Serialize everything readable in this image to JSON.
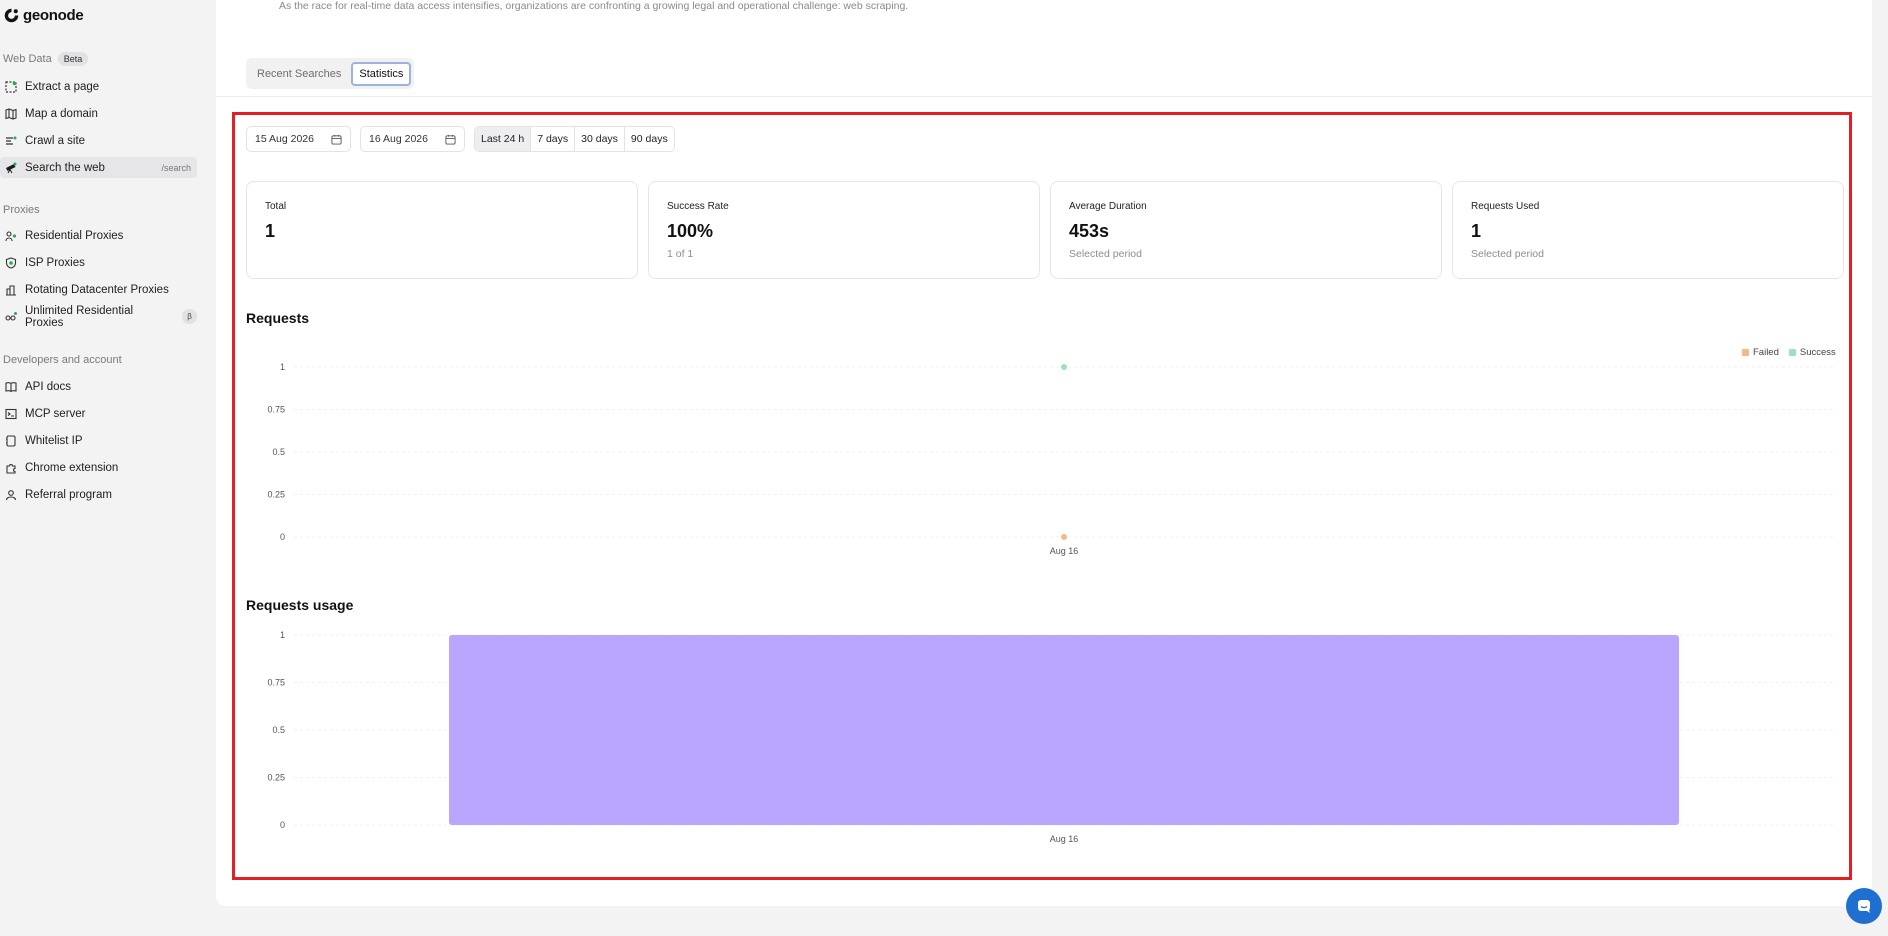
{
  "brand": {
    "name": "geonode"
  },
  "sidebar": {
    "sections": [
      {
        "label": "Web Data",
        "badge": "Beta"
      },
      {
        "label": "Proxies"
      },
      {
        "label": "Developers and account"
      }
    ],
    "web_data_items": [
      {
        "label": "Extract a page",
        "icon": "extract-icon"
      },
      {
        "label": "Map a domain",
        "icon": "map-icon"
      },
      {
        "label": "Crawl a site",
        "icon": "crawl-icon"
      },
      {
        "label": "Search the web",
        "icon": "telescope-icon",
        "shortcut": "/search",
        "active": true
      }
    ],
    "proxy_items": [
      {
        "label": "Residential Proxies",
        "icon": "residential-icon"
      },
      {
        "label": "ISP Proxies",
        "icon": "isp-shield-icon"
      },
      {
        "label": "Rotating Datacenter Proxies",
        "icon": "datacenter-icon"
      },
      {
        "label": "Unlimited Residential Proxies",
        "icon": "unlimited-icon",
        "badge": "β"
      }
    ],
    "dev_items": [
      {
        "label": "API docs",
        "icon": "book-icon"
      },
      {
        "label": "MCP server",
        "icon": "terminal-icon"
      },
      {
        "label": "Whitelist IP",
        "icon": "whitelist-icon"
      },
      {
        "label": "Chrome extension",
        "icon": "puzzle-icon"
      },
      {
        "label": "Referral program",
        "icon": "user-icon"
      }
    ]
  },
  "main": {
    "intro_text": "As the race for real-time data access intensifies, organizations are confronting a growing legal and operational challenge: web scraping.",
    "tabs": [
      {
        "label": "Recent Searches",
        "selected": false
      },
      {
        "label": "Statistics",
        "selected": true
      }
    ]
  },
  "filters": {
    "start_date": "15 Aug 2026",
    "end_date": "16 Aug 2026",
    "ranges": [
      "Last 24 h",
      "7 days",
      "30 days",
      "90 days"
    ],
    "selected_range": "Last 24 h"
  },
  "stats": [
    {
      "label": "Total",
      "value": "1",
      "sub": ""
    },
    {
      "label": "Success Rate",
      "value": "100%",
      "sub": "1 of 1"
    },
    {
      "label": "Average Duration",
      "value": "453s",
      "sub": "Selected period"
    },
    {
      "label": "Requests Used",
      "value": "1",
      "sub": "Selected period"
    }
  ],
  "colors": {
    "failed": "#f5b88a",
    "success": "#9ee3b5",
    "usage_bar": "#b8a6ff",
    "highlight": "#e31e24"
  },
  "chart_data": [
    {
      "type": "scatter",
      "title": "Requests",
      "categories": [
        "Aug 16"
      ],
      "series": [
        {
          "name": "Failed",
          "values": [
            0
          ]
        },
        {
          "name": "Success",
          "values": [
            1
          ]
        }
      ],
      "yticks": [
        "0",
        "0.25",
        "0.5",
        "0.75",
        "1"
      ],
      "ylim": [
        0,
        1
      ],
      "grid": true,
      "legend": "top-right"
    },
    {
      "type": "bar",
      "title": "Requests usage",
      "categories": [
        "Aug 16"
      ],
      "values": [
        1
      ],
      "yticks": [
        "0",
        "0.25",
        "0.5",
        "0.75",
        "1"
      ],
      "ylim": [
        0,
        1
      ],
      "grid": true
    }
  ]
}
